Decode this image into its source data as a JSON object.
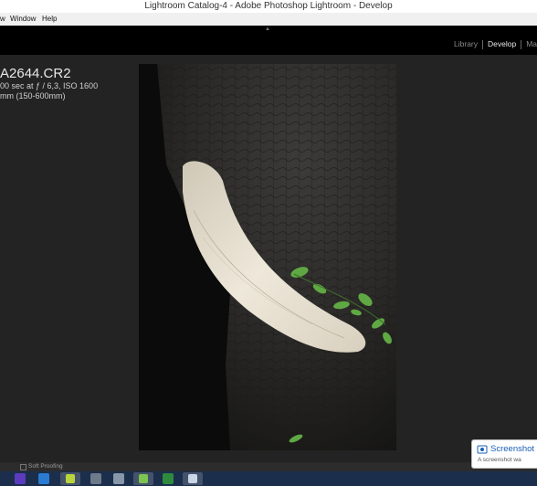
{
  "window": {
    "title": "Lightroom Catalog-4 - Adobe Photoshop Lightroom - Develop"
  },
  "menu": {
    "items": [
      "w",
      "Window",
      "Help"
    ]
  },
  "modules": {
    "library": "Library",
    "develop": "Develop",
    "map": "Ma"
  },
  "photo_info": {
    "filename": "A2644.CR2",
    "exposure": "00 sec at ƒ / 6,3, ISO 1600",
    "lens": "mm (150-600mm)"
  },
  "toolbar": {
    "soft_proofing": "Soft Proofing"
  },
  "notification": {
    "title": "Screenshot",
    "text": "A screenshot wa"
  },
  "colors": {
    "workarea": "#232323",
    "top_panel": "#000000",
    "taskbar": "#1b2e4b",
    "tusk": "#e9e2d2",
    "leaf": "#5fa843"
  },
  "icons": [
    "lightroom-module-indicator-icon",
    "elephant-photo",
    "screenshot-notification-icon",
    "taskbar-app-icons"
  ]
}
